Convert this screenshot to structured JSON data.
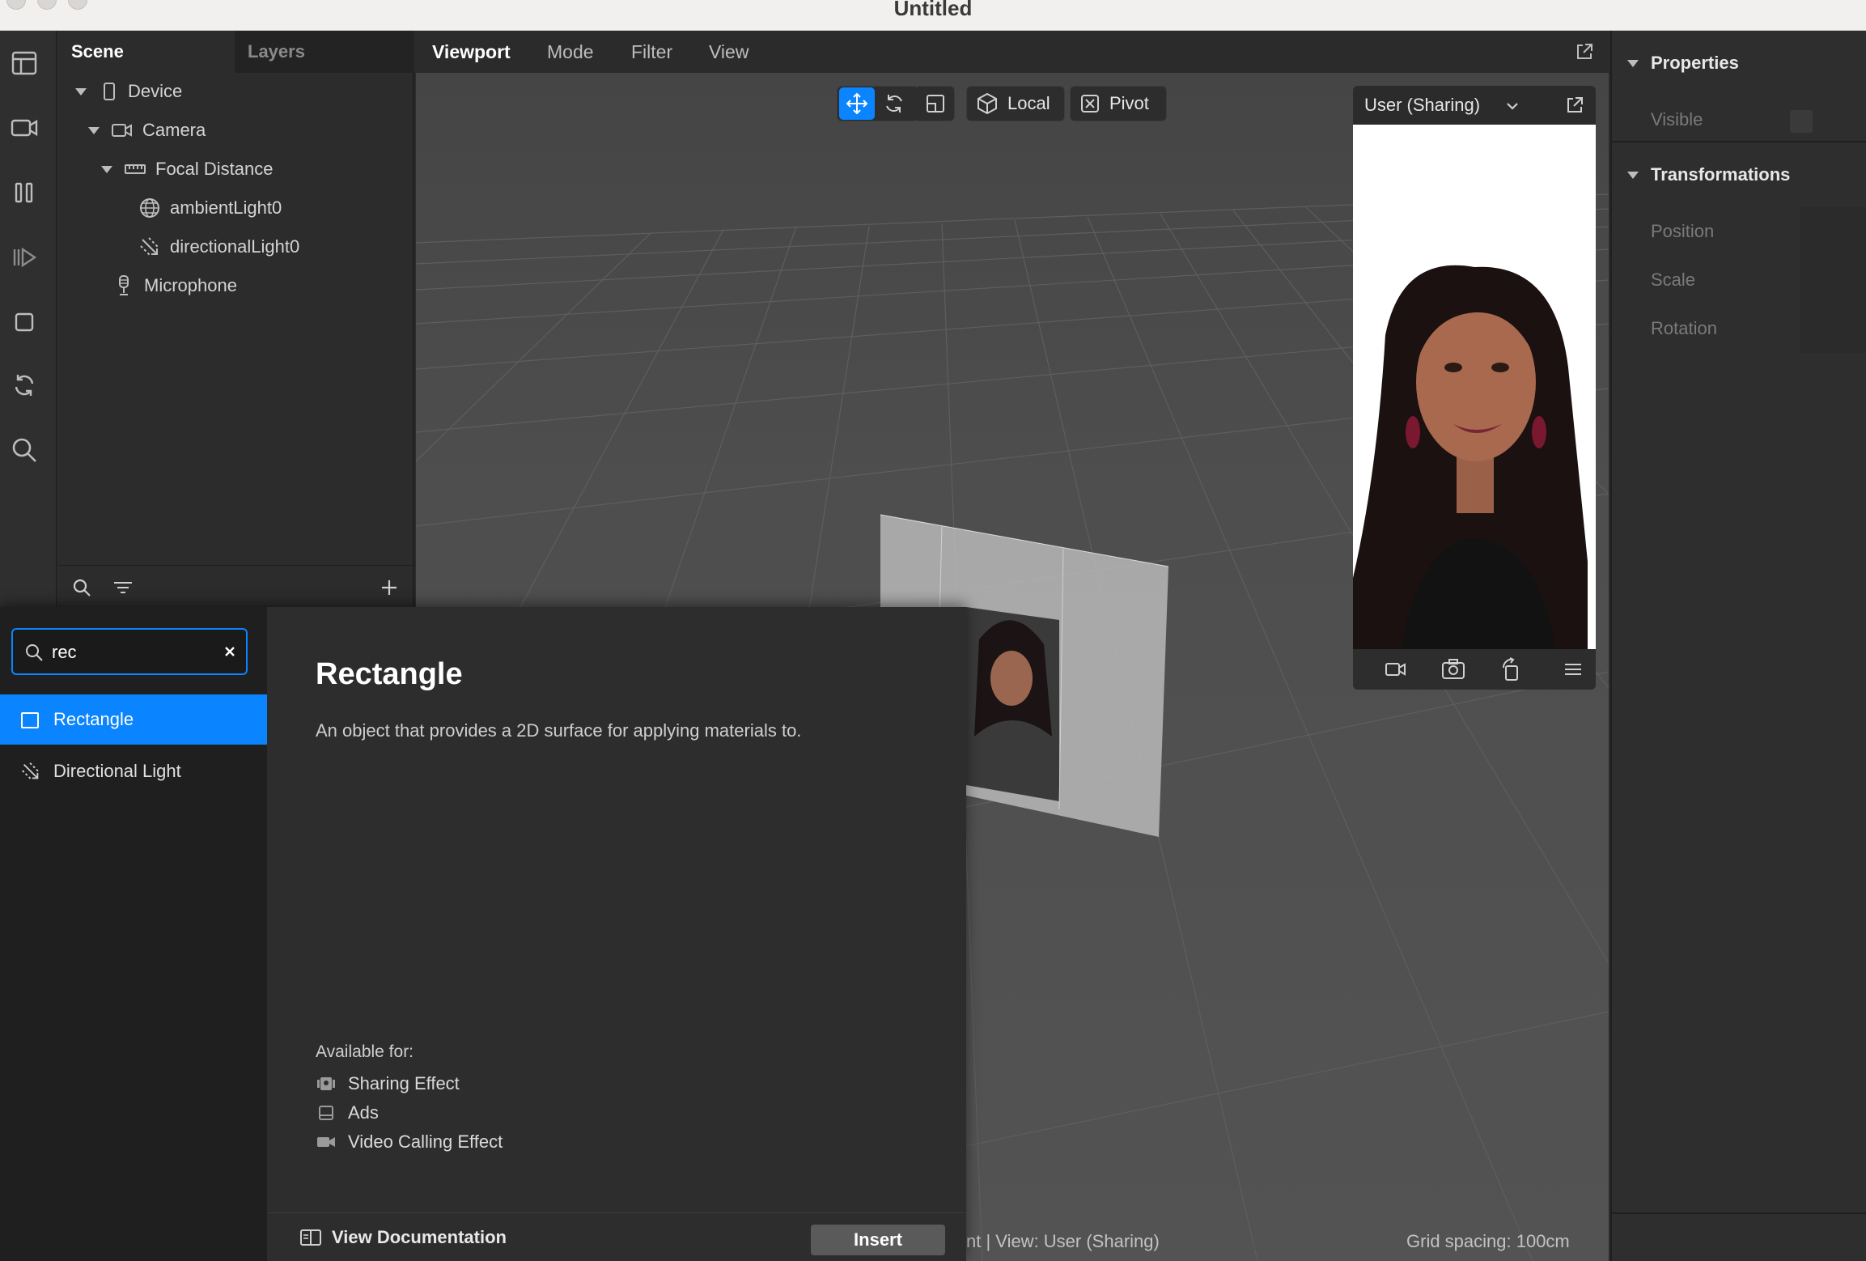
{
  "window": {
    "title": "Untitled"
  },
  "scene_panel": {
    "tabs": [
      {
        "label": "Scene"
      },
      {
        "label": "Layers"
      }
    ],
    "tree": [
      {
        "label": "Device"
      },
      {
        "label": "Camera"
      },
      {
        "label": "Focal Distance"
      },
      {
        "label": "ambientLight0"
      },
      {
        "label": "directionalLight0"
      },
      {
        "label": "Microphone"
      }
    ]
  },
  "viewport": {
    "menu": [
      {
        "label": "Viewport"
      },
      {
        "label": "Mode"
      },
      {
        "label": "Filter"
      },
      {
        "label": "View"
      }
    ],
    "toolbar": {
      "local_label": "Local",
      "pivot_label": "Pivot"
    },
    "preview": {
      "title": "User (Sharing)"
    },
    "status": {
      "left": "nt | View: User (Sharing)",
      "right": "Grid spacing: 100cm"
    }
  },
  "properties": {
    "sections": [
      {
        "label": "Properties"
      },
      {
        "label": "Transformations"
      }
    ],
    "rows": [
      {
        "label": "Visible"
      },
      {
        "label": "Position"
      },
      {
        "label": "Scale"
      },
      {
        "label": "Rotation"
      }
    ]
  },
  "search_popup": {
    "query": "rec",
    "results": [
      {
        "label": "Rectangle"
      },
      {
        "label": "Directional Light"
      }
    ],
    "detail": {
      "title": "Rectangle",
      "description": "An object that provides a 2D surface for applying materials to.",
      "available_label": "Available for:",
      "available": [
        {
          "label": "Sharing Effect"
        },
        {
          "label": "Ads"
        },
        {
          "label": "Video Calling Effect"
        }
      ]
    },
    "doc_label": "View Documentation",
    "insert_label": "Insert"
  },
  "colors": {
    "accent": "#0a84ff",
    "panel": "#2c2c2c",
    "viewport": "#4e4e4e"
  }
}
